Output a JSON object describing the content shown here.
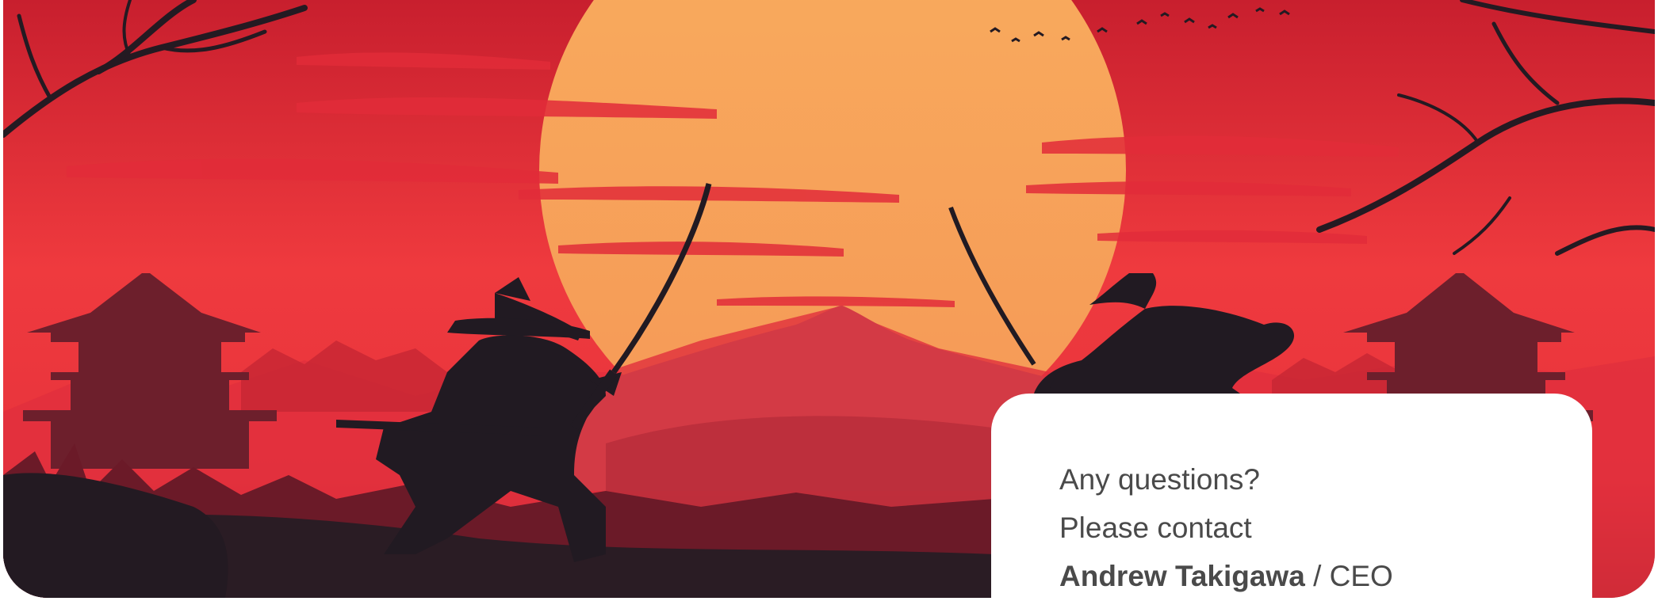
{
  "hero": {
    "image": "samurai-duel-sunset",
    "colors": {
      "sky": "#e8323a",
      "sun": "#f7a55c",
      "silhouette": "#1f1a22",
      "mountain": "#d33a45"
    }
  },
  "contact": {
    "line1": "Any questions?",
    "line2": "Please contact",
    "name": "Andrew Takigawa",
    "separator": " / ",
    "role": "CEO"
  }
}
